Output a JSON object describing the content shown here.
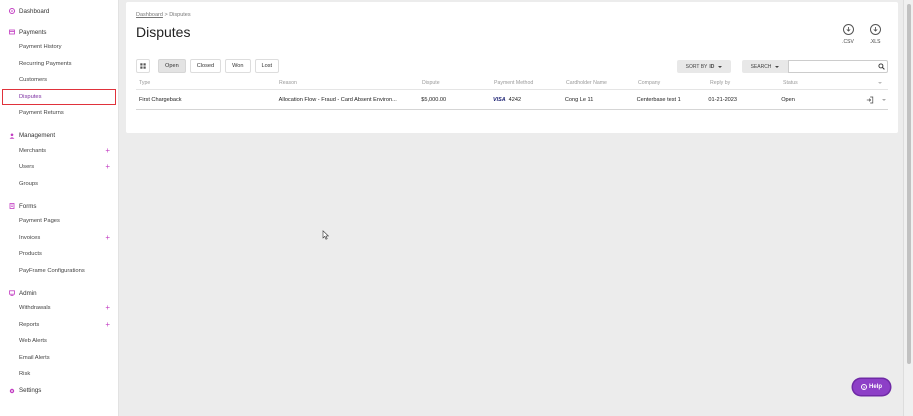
{
  "sidebar": {
    "dashboard": "Dashboard",
    "payments": {
      "title": "Payments",
      "items": [
        "Payment History",
        "Recurring Payments",
        "Customers",
        "Disputes",
        "Payment Returns"
      ]
    },
    "management": {
      "title": "Management",
      "items": [
        "Merchants",
        "Users",
        "Groups"
      ]
    },
    "forms": {
      "title": "Forms",
      "items": [
        "Payment Pages",
        "Invoices",
        "Products",
        "PayFrame Configurations"
      ]
    },
    "admin": {
      "title": "Admin",
      "items": [
        "Withdrawals",
        "Reports",
        "Web Alerts",
        "Email Alerts",
        "Risk"
      ]
    },
    "settings": "Settings",
    "active_item": "Disputes"
  },
  "breadcrumb": {
    "parent": "Dashboard",
    "separator": ">",
    "current": "Disputes"
  },
  "page_title": "Disputes",
  "exports": {
    "csv": ".CSV",
    "xls": ".XLS"
  },
  "tabs": [
    "Open",
    "Closed",
    "Won",
    "Lost"
  ],
  "selected_tab": "Open",
  "sort": {
    "label": "SORT BY",
    "value": "ID"
  },
  "search": {
    "label": "SEARCH",
    "placeholder": "",
    "value": ""
  },
  "table": {
    "headers": [
      "Type",
      "Reason",
      "Dispute",
      "Payment Method",
      "Cardholder Name",
      "Company",
      "Reply by",
      "Status"
    ],
    "rows": [
      {
        "type": "First Chargeback",
        "reason": "Allocation Flow - Fraud - Card Absent Environ...",
        "dispute": "$5,000.00",
        "card_brand": "VISA",
        "card_last4": "4242",
        "cardholder": "Cong Le 11",
        "company": "Centerbase test 1",
        "reply_by": "01-21-2023",
        "status": "Open"
      }
    ]
  },
  "help": {
    "label": "Help"
  },
  "colors": {
    "accent_purple": "#8d3fc7",
    "plus_magenta": "#c23cc2",
    "active_border": "#e0323b",
    "visa_blue": "#1a1f71"
  }
}
